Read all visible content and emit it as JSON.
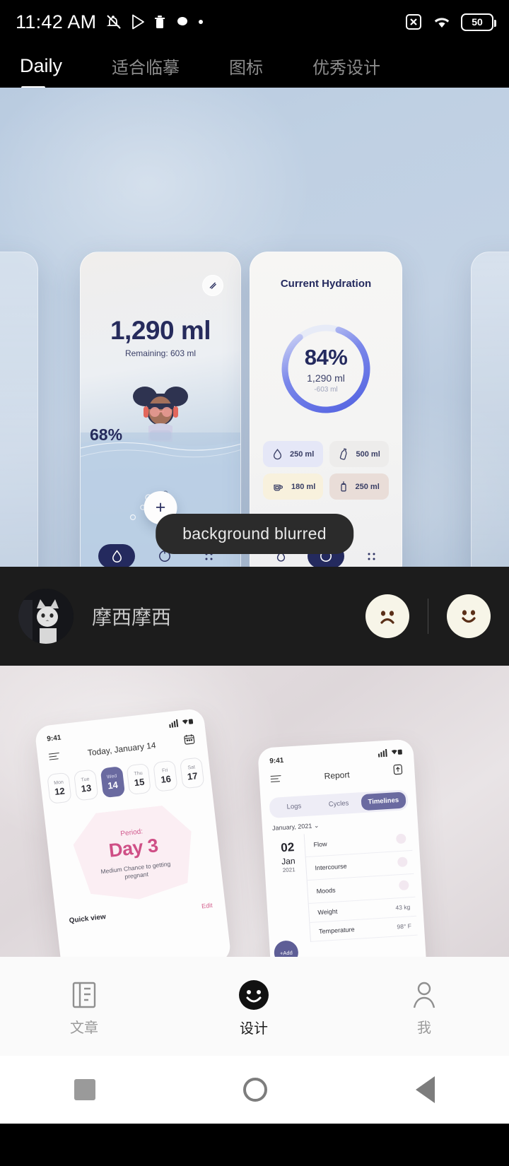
{
  "status_bar": {
    "time": "11:42 AM",
    "left_icons": [
      "mute-icon",
      "play-store-icon",
      "trash-icon",
      "cloud-icon",
      "dot-icon"
    ],
    "right_icons": [
      "no-sim-icon",
      "wifi-icon"
    ],
    "battery": "50"
  },
  "tabs": [
    {
      "label": "Daily",
      "active": true
    },
    {
      "label": "适合临摹",
      "active": false
    },
    {
      "label": "图标",
      "active": false
    },
    {
      "label": "优秀设计",
      "active": false
    }
  ],
  "hero": {
    "caption_pill": "background blurred",
    "card_one": {
      "amount": "1,290 ml",
      "remaining": "Remaining: 603 ml",
      "percent_label": "68%",
      "add_button": "+",
      "edit_icon": "edit-pencil-icon",
      "nav_icons": [
        "water-drop-icon",
        "progress-ring-icon",
        "grid-dots-icon"
      ]
    },
    "card_two": {
      "title": "Current Hydration",
      "ring_percent": "84%",
      "ring_amount": "1,290 ml",
      "ring_remaining": "-603 ml",
      "ring_value": 84,
      "quick_add": [
        {
          "icon": "water-drop-icon",
          "label": "250 ml",
          "color": "#e5e7f7"
        },
        {
          "icon": "bottle-icon",
          "label": "500 ml",
          "color": "#edeceb"
        },
        {
          "icon": "tea-cup-icon",
          "label": "180 ml",
          "color": "#f8f1dd"
        },
        {
          "icon": "french-press-icon",
          "label": "250 ml",
          "color": "#e9ddd8"
        }
      ],
      "nav_icons": [
        "water-drop-icon",
        "progress-ring-icon",
        "grid-dots-icon"
      ]
    }
  },
  "author": {
    "name": "摩西摩西",
    "avatar": "cat-avatar",
    "reactions": [
      {
        "name": "sad-face-reaction"
      },
      {
        "name": "happy-face-reaction"
      }
    ]
  },
  "preview_two": {
    "phone_a": {
      "status_time": "9:41",
      "header_title": "Today, January 14",
      "menu_icon": "hamburger-icon",
      "calendar_icon": "calendar-icon",
      "days": [
        {
          "name": "Mon",
          "num": "12",
          "selected": false
        },
        {
          "name": "Tue",
          "num": "13",
          "selected": false
        },
        {
          "name": "Wed",
          "num": "14",
          "selected": true
        },
        {
          "name": "Thu",
          "num": "15",
          "selected": false
        },
        {
          "name": "Fri",
          "num": "16",
          "selected": false
        },
        {
          "name": "Sat",
          "num": "17",
          "selected": false
        }
      ],
      "period_label": "Period:",
      "period_day": "Day 3",
      "period_note": "Medium Chance to getting pregnant",
      "quick_view": "Quick view",
      "edit_link": "Edit"
    },
    "phone_b": {
      "status_time": "9:41",
      "header_title": "Report",
      "menu_icon": "hamburger-icon",
      "export_icon": "export-icon",
      "segments": [
        {
          "label": "Logs",
          "active": false
        },
        {
          "label": "Cycles",
          "active": false
        },
        {
          "label": "Timelines",
          "active": true
        }
      ],
      "month_selector": "January, 2021",
      "entry_date": {
        "day": "02",
        "month": "Jan",
        "year": "2021"
      },
      "rows": [
        {
          "label": "Flow",
          "value": ""
        },
        {
          "label": "Intercourse",
          "value": ""
        },
        {
          "label": "Moods",
          "value": ""
        },
        {
          "label": "Weight",
          "value": "43 kg"
        },
        {
          "label": "Temperature",
          "value": "98° F"
        }
      ],
      "add_button": "+Add"
    }
  },
  "app_nav": [
    {
      "label": "文章",
      "icon": "article-icon",
      "active": false
    },
    {
      "label": "设计",
      "icon": "smiley-icon",
      "active": true
    },
    {
      "label": "我",
      "icon": "person-icon",
      "active": false
    }
  ],
  "system_nav": [
    {
      "name": "recents-button",
      "icon": "square-icon"
    },
    {
      "name": "home-button",
      "icon": "circle-icon"
    },
    {
      "name": "back-button",
      "icon": "triangle-icon"
    }
  ],
  "colors": {
    "accent_navy": "#242a5e",
    "accent_blue": "#5b6ee0",
    "accent_purple": "#6a6aa0",
    "accent_pink": "#cf4f86"
  }
}
